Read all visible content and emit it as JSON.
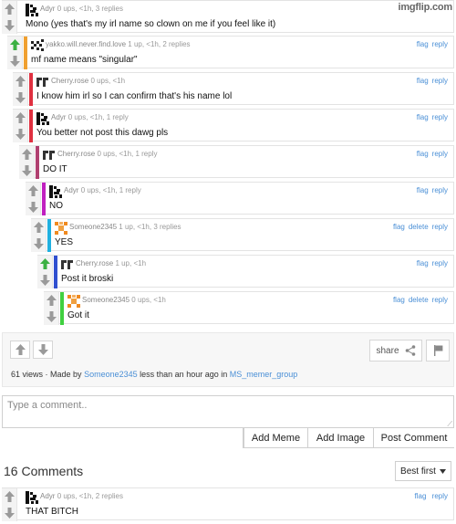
{
  "watermark": "imgflip.com",
  "actions": {
    "flag": "flag",
    "reply": "reply",
    "delete": "delete"
  },
  "comments": [
    {
      "user": "Adyr",
      "info": "0 ups, <1h, 3 replies",
      "text": "Mono (yes that's my irl name so clown on me if you feel like it)",
      "bar": "",
      "avatar": "adyr",
      "upvoted": false
    },
    {
      "user": "yakko.will.never.find.love",
      "info": "1 up, <1h, 2 replies",
      "text": "mf name means \"singular\"",
      "bar": "#f0a030",
      "avatar": "yakko",
      "upvoted": true
    },
    {
      "user": "Cherry.rose",
      "info": "0 ups, <1h",
      "text": "I know him irl so I can confirm that's his name lol",
      "bar": "#e03040",
      "avatar": "cherry",
      "upvoted": false
    },
    {
      "user": "Adyr",
      "info": "0 ups, <1h, 1 reply",
      "text": "You better not post this dawg pls",
      "bar": "#e03040",
      "avatar": "adyr",
      "upvoted": false
    },
    {
      "user": "Cherry.rose",
      "info": "0 ups, <1h, 1 reply",
      "text": "DO IT",
      "bar": "#b04070",
      "avatar": "cherry",
      "upvoted": false
    },
    {
      "user": "Adyr",
      "info": "0 ups, <1h, 1 reply",
      "text": "NO",
      "bar": "#c020c0",
      "avatar": "adyr",
      "upvoted": false
    },
    {
      "user": "Someone2345",
      "info": "1 up, <1h, 3 replies",
      "text": "YES",
      "bar": "#20b0e0",
      "avatar": "someone",
      "upvoted": false,
      "deletable": true
    },
    {
      "user": "Cherry.rose",
      "info": "1 up, <1h",
      "text": "Post it broski",
      "bar": "#3050d0",
      "avatar": "cherry",
      "upvoted": true
    },
    {
      "user": "Someone2345",
      "info": "0 ups, <1h",
      "text": "Got it",
      "bar": "#40d040",
      "avatar": "someone",
      "upvoted": false,
      "deletable": true
    }
  ],
  "post": {
    "share_label": "share",
    "views": "61 views",
    "made_by_prefix": "· Made by",
    "author": "Someone2345",
    "time_text": "less than an hour ago in",
    "stream": "MS_memer_group"
  },
  "comment_form": {
    "placeholder": "Type a comment..",
    "add_meme": "Add Meme",
    "add_image": "Add Image",
    "post_comment": "Post Comment"
  },
  "comments_header": {
    "count_label": "16 Comments",
    "sort_value": "Best first"
  },
  "top_comment": {
    "user": "Adyr",
    "info": "0 ups, <1h, 2 replies",
    "text": "THAT BITCH",
    "avatar": "adyr"
  },
  "colors": {
    "link": "#4a8fd6",
    "upvote_green": "#3cb043",
    "vote_gray": "#9a9a9a"
  }
}
